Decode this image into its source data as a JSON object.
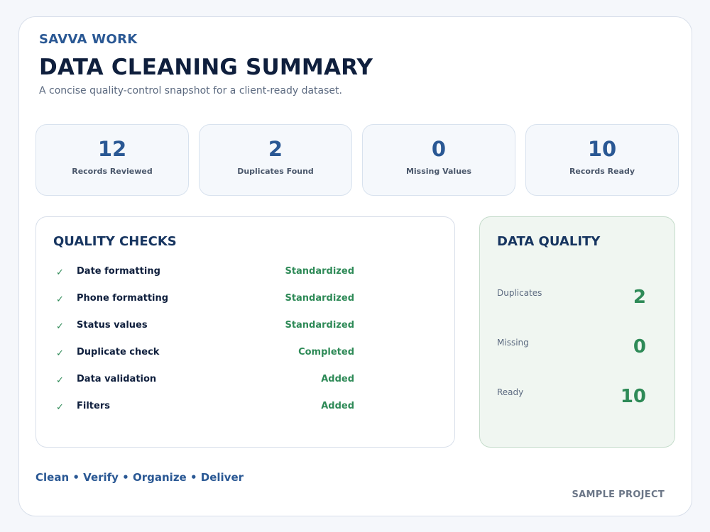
{
  "header": {
    "brand": "SAVVA WORK",
    "title": "DATA CLEANING SUMMARY",
    "subtitle": "A concise quality-control snapshot for a client-ready dataset."
  },
  "stats": [
    {
      "value": "12",
      "label": "Records Reviewed"
    },
    {
      "value": "2",
      "label": "Duplicates Found"
    },
    {
      "value": "0",
      "label": "Missing Values"
    },
    {
      "value": "10",
      "label": "Records Ready"
    }
  ],
  "quality_checks": {
    "title": "QUALITY CHECKS",
    "check_icon": "✓",
    "items": [
      {
        "name": "Date formatting",
        "status": "Standardized"
      },
      {
        "name": "Phone formatting",
        "status": "Standardized"
      },
      {
        "name": "Status values",
        "status": "Standardized"
      },
      {
        "name": "Duplicate check",
        "status": "Completed"
      },
      {
        "name": "Data validation",
        "status": "Added"
      },
      {
        "name": "Filters",
        "status": "Added"
      }
    ]
  },
  "data_quality": {
    "title": "DATA QUALITY",
    "rows": [
      {
        "label": "Duplicates",
        "value": "2"
      },
      {
        "label": "Missing",
        "value": "0"
      },
      {
        "label": "Ready",
        "value": "10"
      }
    ]
  },
  "footer": {
    "tagline": "Clean • Verify • Organize • Deliver",
    "badge": "SAMPLE PROJECT"
  },
  "colors": {
    "accent": "#2a5894",
    "success": "#2e8a57",
    "title": "#0f1f3d"
  }
}
